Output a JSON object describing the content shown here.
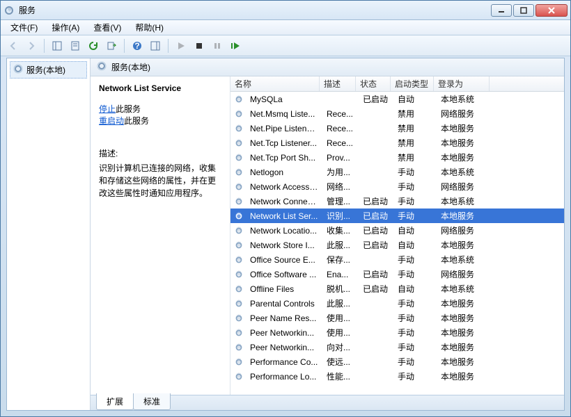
{
  "window": {
    "title": "服务"
  },
  "menu": [
    "文件(F)",
    "操作(A)",
    "查看(V)",
    "帮助(H)"
  ],
  "tree": {
    "root": "服务(本地)"
  },
  "pane": {
    "header": "服务(本地)"
  },
  "detail": {
    "name": "Network List Service",
    "stop_label": "停止",
    "stop_suffix": "此服务",
    "restart_label": "重启动",
    "restart_suffix": "此服务",
    "desc_label": "描述:",
    "desc_text": "识别计算机已连接的网络，收集和存储这些网络的属性，并在更改这些属性时通知应用程序。"
  },
  "columns": {
    "name": "名称",
    "desc": "描述",
    "status": "状态",
    "start": "启动类型",
    "login": "登录为"
  },
  "tabs": {
    "extended": "扩展",
    "standard": "标准"
  },
  "services": [
    {
      "name": "MySQLa",
      "desc": "",
      "status": "已启动",
      "start": "自动",
      "login": "本地系统"
    },
    {
      "name": "Net.Msmq Liste...",
      "desc": "Rece...",
      "status": "",
      "start": "禁用",
      "login": "网络服务"
    },
    {
      "name": "Net.Pipe Listene...",
      "desc": "Rece...",
      "status": "",
      "start": "禁用",
      "login": "本地服务"
    },
    {
      "name": "Net.Tcp Listener...",
      "desc": "Rece...",
      "status": "",
      "start": "禁用",
      "login": "本地服务"
    },
    {
      "name": "Net.Tcp Port Sh...",
      "desc": "Prov...",
      "status": "",
      "start": "禁用",
      "login": "本地服务"
    },
    {
      "name": "Netlogon",
      "desc": "为用...",
      "status": "",
      "start": "手动",
      "login": "本地系统"
    },
    {
      "name": "Network Access ...",
      "desc": "网络...",
      "status": "",
      "start": "手动",
      "login": "网络服务"
    },
    {
      "name": "Network Connec...",
      "desc": "管理...",
      "status": "已启动",
      "start": "手动",
      "login": "本地系统"
    },
    {
      "name": "Network List Ser...",
      "desc": "识别...",
      "status": "已启动",
      "start": "手动",
      "login": "本地服务",
      "selected": true
    },
    {
      "name": "Network Locatio...",
      "desc": "收集...",
      "status": "已启动",
      "start": "自动",
      "login": "网络服务"
    },
    {
      "name": "Network Store I...",
      "desc": "此服...",
      "status": "已启动",
      "start": "自动",
      "login": "本地服务"
    },
    {
      "name": "Office  Source E...",
      "desc": "保存...",
      "status": "",
      "start": "手动",
      "login": "本地系统"
    },
    {
      "name": "Office Software ...",
      "desc": "Ena...",
      "status": "已启动",
      "start": "手动",
      "login": "网络服务"
    },
    {
      "name": "Offline Files",
      "desc": "脱机...",
      "status": "已启动",
      "start": "自动",
      "login": "本地系统"
    },
    {
      "name": "Parental Controls",
      "desc": "此服...",
      "status": "",
      "start": "手动",
      "login": "本地服务"
    },
    {
      "name": "Peer Name Res...",
      "desc": "使用...",
      "status": "",
      "start": "手动",
      "login": "本地服务"
    },
    {
      "name": "Peer Networkin...",
      "desc": "使用...",
      "status": "",
      "start": "手动",
      "login": "本地服务"
    },
    {
      "name": "Peer Networkin...",
      "desc": "向对...",
      "status": "",
      "start": "手动",
      "login": "本地服务"
    },
    {
      "name": "Performance Co...",
      "desc": "使远...",
      "status": "",
      "start": "手动",
      "login": "本地服务"
    },
    {
      "name": "Performance Lo...",
      "desc": "性能...",
      "status": "",
      "start": "手动",
      "login": "本地服务"
    }
  ]
}
